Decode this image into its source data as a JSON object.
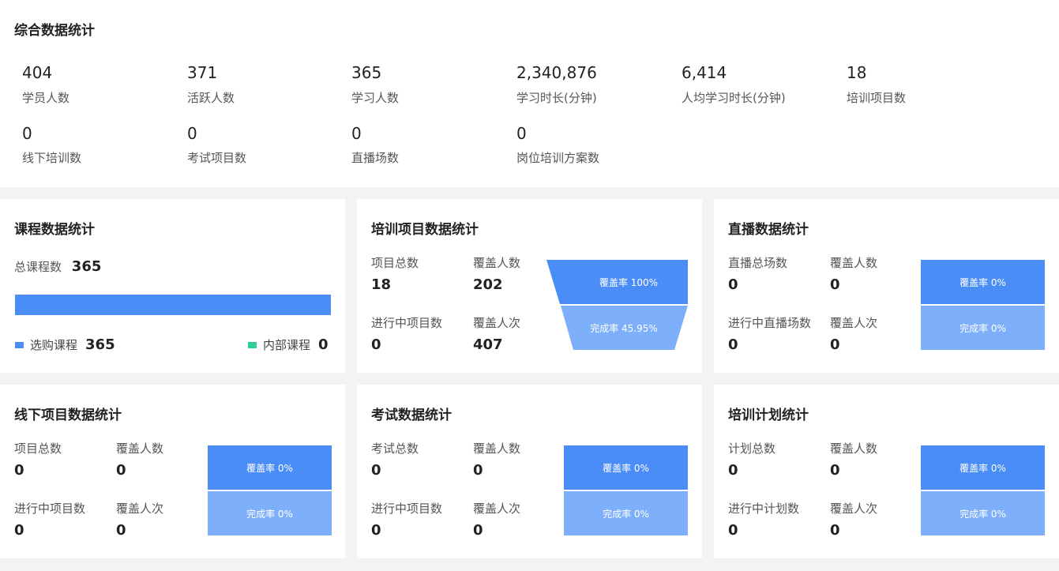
{
  "overview": {
    "title": "综合数据统计",
    "row1": [
      {
        "value": "404",
        "label": "学员人数"
      },
      {
        "value": "371",
        "label": "活跃人数"
      },
      {
        "value": "365",
        "label": "学习人数"
      },
      {
        "value": "2,340,876",
        "label": "学习时长(分钟)"
      },
      {
        "value": "6,414",
        "label": "人均学习时长(分钟)"
      },
      {
        "value": "18",
        "label": "培训项目数"
      }
    ],
    "row2": [
      {
        "value": "0",
        "label": "线下培训数"
      },
      {
        "value": "0",
        "label": "考试项目数"
      },
      {
        "value": "0",
        "label": "直播场数"
      },
      {
        "value": "0",
        "label": "岗位培训方案数"
      }
    ]
  },
  "course": {
    "title": "课程数据统计",
    "total_label": "总课程数",
    "total_value": "365",
    "bar_fill_fraction": 1.0,
    "legend": [
      {
        "label": "选购课程",
        "value": "365",
        "color": "#4a8df6"
      },
      {
        "label": "内部课程",
        "value": "0",
        "color": "#2fcf9a"
      }
    ]
  },
  "training": {
    "title": "培训项目数据统计",
    "stats": [
      {
        "label": "项目总数",
        "value": "18"
      },
      {
        "label": "覆盖人数",
        "value": "202"
      },
      {
        "label": "进行中项目数",
        "value": "0"
      },
      {
        "label": "覆盖人次",
        "value": "407"
      }
    ],
    "coverage": "覆盖率 100%",
    "completion": "完成率 45.95%"
  },
  "live": {
    "title": "直播数据统计",
    "stats": [
      {
        "label": "直播总场数",
        "value": "0"
      },
      {
        "label": "覆盖人数",
        "value": "0"
      },
      {
        "label": "进行中直播场数",
        "value": "0"
      },
      {
        "label": "覆盖人次",
        "value": "0"
      }
    ],
    "coverage": "覆盖率 0%",
    "completion": "完成率 0%"
  },
  "offline": {
    "title": "线下项目数据统计",
    "stats": [
      {
        "label": "项目总数",
        "value": "0"
      },
      {
        "label": "覆盖人数",
        "value": "0"
      },
      {
        "label": "进行中项目数",
        "value": "0"
      },
      {
        "label": "覆盖人次",
        "value": "0"
      }
    ],
    "coverage": "覆盖率 0%",
    "completion": "完成率 0%"
  },
  "exam": {
    "title": "考试数据统计",
    "stats": [
      {
        "label": "考试总数",
        "value": "0"
      },
      {
        "label": "覆盖人数",
        "value": "0"
      },
      {
        "label": "进行中项目数",
        "value": "0"
      },
      {
        "label": "覆盖人次",
        "value": "0"
      }
    ],
    "coverage": "覆盖率 0%",
    "completion": "完成率 0%"
  },
  "plan": {
    "title": "培训计划统计",
    "stats": [
      {
        "label": "计划总数",
        "value": "0"
      },
      {
        "label": "覆盖人数",
        "value": "0"
      },
      {
        "label": "进行中计划数",
        "value": "0"
      },
      {
        "label": "覆盖人次",
        "value": "0"
      }
    ],
    "coverage": "覆盖率 0%",
    "completion": "完成率 0%"
  }
}
